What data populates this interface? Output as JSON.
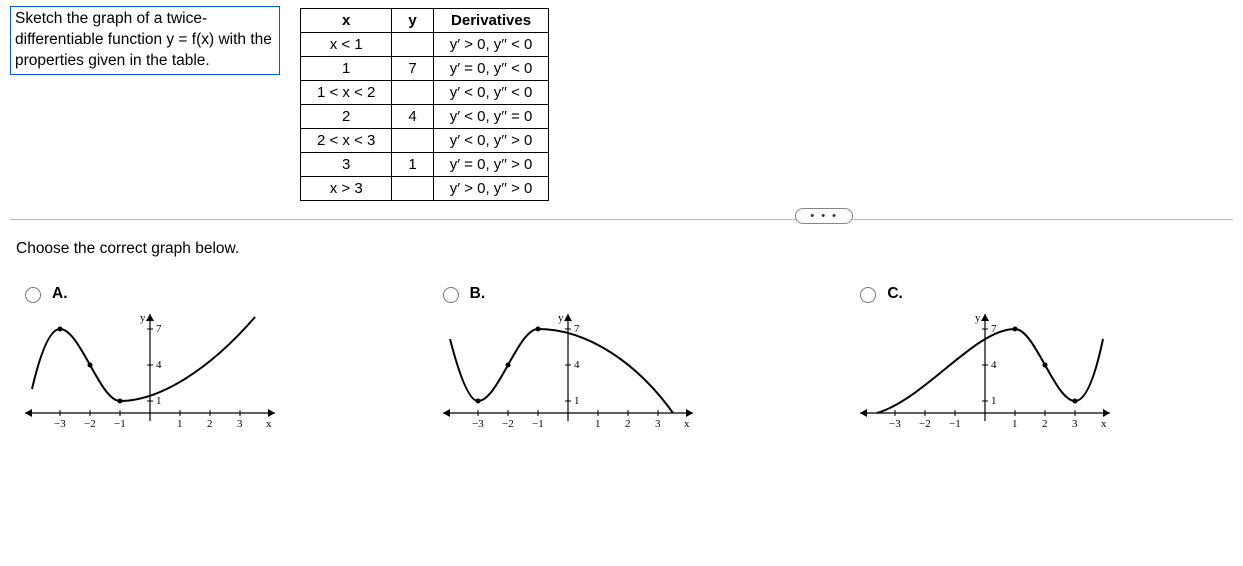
{
  "question_text": "Sketch the graph of a twice-differentiable function y = f(x) with the properties given in the table.",
  "table": {
    "headers": {
      "x": "x",
      "y": "y",
      "deriv": "Derivatives"
    },
    "rows": [
      {
        "x": "x < 1",
        "y": "",
        "d": "y′ > 0, y′′ < 0"
      },
      {
        "x": "1",
        "y": "7",
        "d": "y′ = 0, y′′ < 0"
      },
      {
        "x": "1 < x < 2",
        "y": "",
        "d": "y′ < 0, y′′ < 0"
      },
      {
        "x": "2",
        "y": "4",
        "d": "y′ < 0, y′′ = 0"
      },
      {
        "x": "2 < x < 3",
        "y": "",
        "d": "y′ < 0, y′′ > 0"
      },
      {
        "x": "3",
        "y": "1",
        "d": "y′ = 0, y′′ > 0"
      },
      {
        "x": "x > 3",
        "y": "",
        "d": "y′ > 0, y′′ > 0"
      }
    ]
  },
  "dots": "• • •",
  "prompt2": "Choose the correct graph below.",
  "options": {
    "a": "A.",
    "b": "B.",
    "c": "C."
  },
  "axis_labels": {
    "x": "x",
    "y": "y"
  },
  "ticks": {
    "x": [
      "−3",
      "−2",
      "−1",
      "1",
      "2",
      "3"
    ],
    "y": [
      "1",
      "4",
      "7"
    ]
  },
  "chart_data": [
    {
      "type": "line",
      "option": "A",
      "xlim": [
        -4,
        4
      ],
      "ylim": [
        0,
        8
      ],
      "xticks": [
        -3,
        -2,
        -1,
        1,
        2,
        3
      ],
      "yticks": [
        1,
        4,
        7
      ],
      "description": "Max (-3,7), inflection (-2,4), min (-1,1), then rises concave-up through positive x",
      "points": [
        {
          "x": -4.0,
          "y": 2.0
        },
        {
          "x": -3.0,
          "y": 7.0
        },
        {
          "x": -2.0,
          "y": 4.0
        },
        {
          "x": -1.0,
          "y": 1.0
        },
        {
          "x": 0.5,
          "y": 2.0
        },
        {
          "x": 2.0,
          "y": 4.5
        },
        {
          "x": 3.5,
          "y": 8.0
        }
      ]
    },
    {
      "type": "line",
      "option": "B",
      "xlim": [
        -4,
        4
      ],
      "ylim": [
        0,
        8
      ],
      "xticks": [
        -3,
        -2,
        -1,
        1,
        2,
        3
      ],
      "yticks": [
        1,
        4,
        7
      ],
      "description": "Min (-3,1), inflection (-2,4), max (-1,7), then falls concave-down through positive x",
      "points": [
        {
          "x": -4.0,
          "y": 6.0
        },
        {
          "x": -3.0,
          "y": 1.0
        },
        {
          "x": -2.0,
          "y": 4.0
        },
        {
          "x": -1.0,
          "y": 7.0
        },
        {
          "x": 0.5,
          "y": 6.5
        },
        {
          "x": 2.0,
          "y": 4.0
        },
        {
          "x": 3.5,
          "y": 0.0
        }
      ]
    },
    {
      "type": "line",
      "option": "C",
      "xlim": [
        -4,
        4
      ],
      "ylim": [
        0,
        8
      ],
      "xticks": [
        -3,
        -2,
        -1,
        1,
        2,
        3
      ],
      "yticks": [
        1,
        4,
        7
      ],
      "description": "Rises concave-up from left, max (1,7), inflection (2,4), min (3,1), then rises",
      "points": [
        {
          "x": -3.5,
          "y": 0.0
        },
        {
          "x": -2.0,
          "y": 2.0
        },
        {
          "x": 0.0,
          "y": 5.5
        },
        {
          "x": 1.0,
          "y": 7.0
        },
        {
          "x": 2.0,
          "y": 4.0
        },
        {
          "x": 3.0,
          "y": 1.0
        },
        {
          "x": 4.0,
          "y": 6.0
        }
      ]
    }
  ]
}
